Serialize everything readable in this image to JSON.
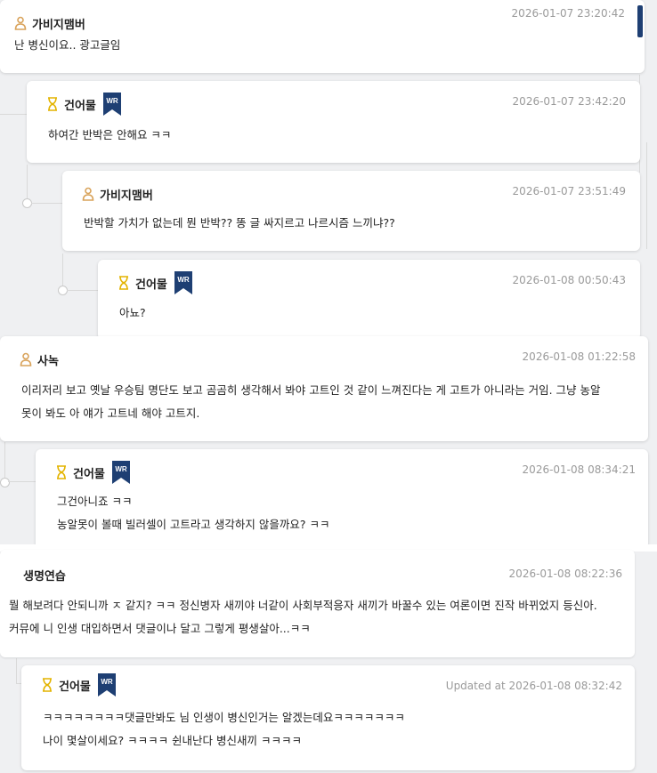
{
  "comments": [
    {
      "author": "가비지맴버",
      "time": "2026-01-07 23:20:42",
      "lines": [
        "난 병신이요.. 광고글임"
      ],
      "wr": false
    },
    {
      "author": "건어물",
      "time": "2026-01-07 23:42:20",
      "lines": [
        "하여간 반박은 안해요 ㅋㅋ"
      ],
      "wr": true
    },
    {
      "author": "가비지맴버",
      "time": "2026-01-07 23:51:49",
      "lines": [
        "반박할 가치가 없는데 뭔 반박?? 똥 글 싸지르고 나르시즘 느끼냐??"
      ],
      "wr": false
    },
    {
      "author": "건어물",
      "time": "2026-01-08 00:50:43",
      "lines": [
        "아뇨?"
      ],
      "wr": true
    },
    {
      "author": "사녹",
      "time": "2026-01-08 01:22:58",
      "lines": [
        "이리저리 보고 옛날 우승팀 명단도 보고 곰곰히 생각해서 봐야 고트인 것 같이 느껴진다는 게 고트가 아니라는 거임. 그냥 농알",
        "못이 봐도 아 얘가 고트네 해야 고트지."
      ],
      "wr": false
    },
    {
      "author": "건어물",
      "time": "2026-01-08 08:34:21",
      "lines": [
        "그건아니죠 ㅋㅋ",
        "농알못이 볼때 빌러셀이 고트라고 생각하지 않을까요? ㅋㅋ"
      ],
      "wr": true
    },
    {
      "author": "생명연습",
      "time": "2026-01-08 08:22:36",
      "lines": [
        "뭘 해보려다 안되니까 ㅈ 같지? ㅋㅋ 정신병자 새끼야 너같이 사회부적응자 새끼가 바꿀수 있는 여론이면 진작 바뀌었지 등신아.",
        "커뮤에 니 인생 대입하면서 댓글이나 달고 그렇게 평생살아...ㅋㅋ"
      ],
      "wr": false
    },
    {
      "author": "건어물",
      "time": "Updated at 2026-01-08 08:32:42",
      "lines": [
        "ㅋㅋㅋㅋㅋㅋㅋㅋ댓글만봐도 님 인생이 병신인거는 알겠는데요ㅋㅋㅋㅋㅋㅋㅋ",
        "나이 몇살이세요? ㅋㅋㅋㅋ 쉰내난다 병신새끼 ㅋㅋㅋㅋ"
      ],
      "wr": true
    }
  ],
  "badge_label": "WR",
  "icons": {
    "member": "user-icon",
    "owner": "hourglass-icon",
    "writer": "wr-bookmark-badge"
  },
  "colors": {
    "badge": "#1e3f73",
    "member_icon": "#d9a35b",
    "owner_icon": "#e3b400",
    "time": "#9a9a9a"
  }
}
